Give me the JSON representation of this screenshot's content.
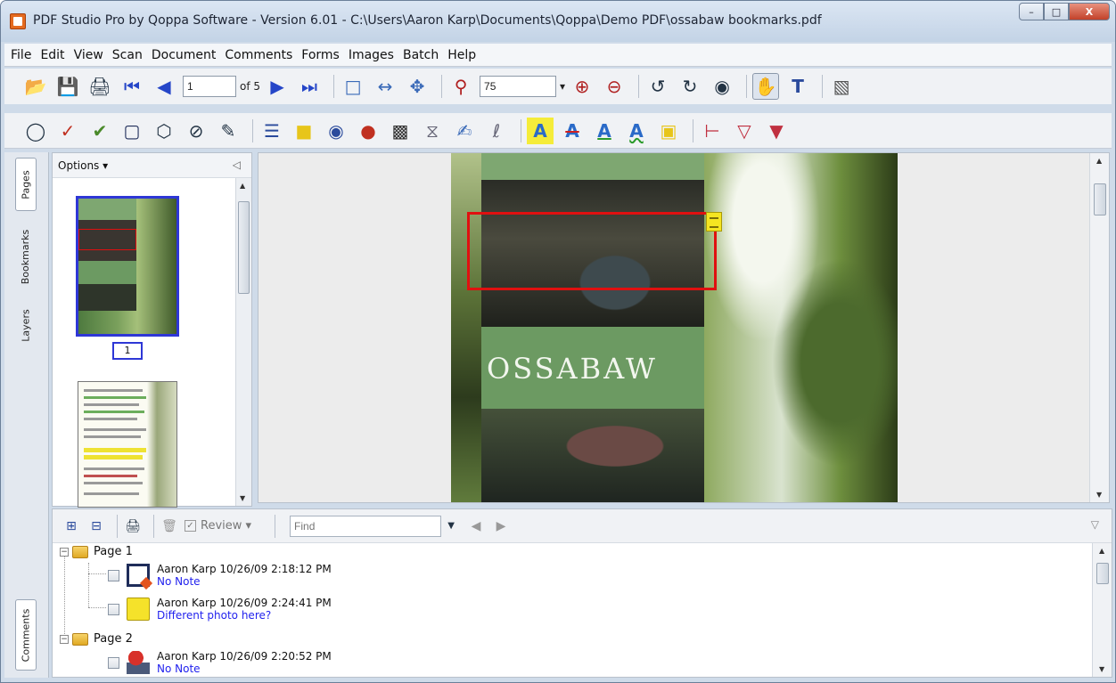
{
  "window": {
    "title": "PDF Studio Pro by Qoppa Software - Version 6.01 - C:\\Users\\Aaron Karp\\Documents\\Qoppa\\Demo PDF\\ossabaw bookmarks.pdf",
    "minimize_glyph": "–",
    "maximize_glyph": "□",
    "close_glyph": "X"
  },
  "menu": [
    "File",
    "Edit",
    "View",
    "Scan",
    "Document",
    "Comments",
    "Forms",
    "Images",
    "Batch",
    "Help"
  ],
  "toolbar": {
    "page_input": "1",
    "page_of": "of 5",
    "zoom_value": "75",
    "zoom_dropdown": "▾"
  },
  "side_tabs": {
    "pages": "Pages",
    "bookmarks": "Bookmarks",
    "layers": "Layers",
    "comments": "Comments"
  },
  "thumbnails": {
    "options_label": "Options ▾",
    "page1_number": "1"
  },
  "document": {
    "page_title_text": "OSSABAW"
  },
  "comments_panel": {
    "review_label": "Review ▾",
    "find_placeholder": "Find",
    "pages": [
      {
        "label": "Page 1",
        "items": [
          {
            "author_time": "Aaron Karp 10/26/09 2:18:12 PM",
            "note": "No Note",
            "type": "rectangle"
          },
          {
            "author_time": "Aaron Karp 10/26/09 2:24:41 PM",
            "note": "Different photo here?",
            "type": "sticky-note"
          }
        ]
      },
      {
        "label": "Page 2",
        "items": [
          {
            "author_time": "Aaron Karp 10/26/09 2:20:52 PM",
            "note": "No Note",
            "type": "stamp"
          }
        ]
      }
    ]
  },
  "colors": {
    "annotation_red": "#e01010",
    "selection_blue": "#2e37d6",
    "note_link_blue": "#2222ee",
    "sticky_yellow": "#f5e521"
  }
}
